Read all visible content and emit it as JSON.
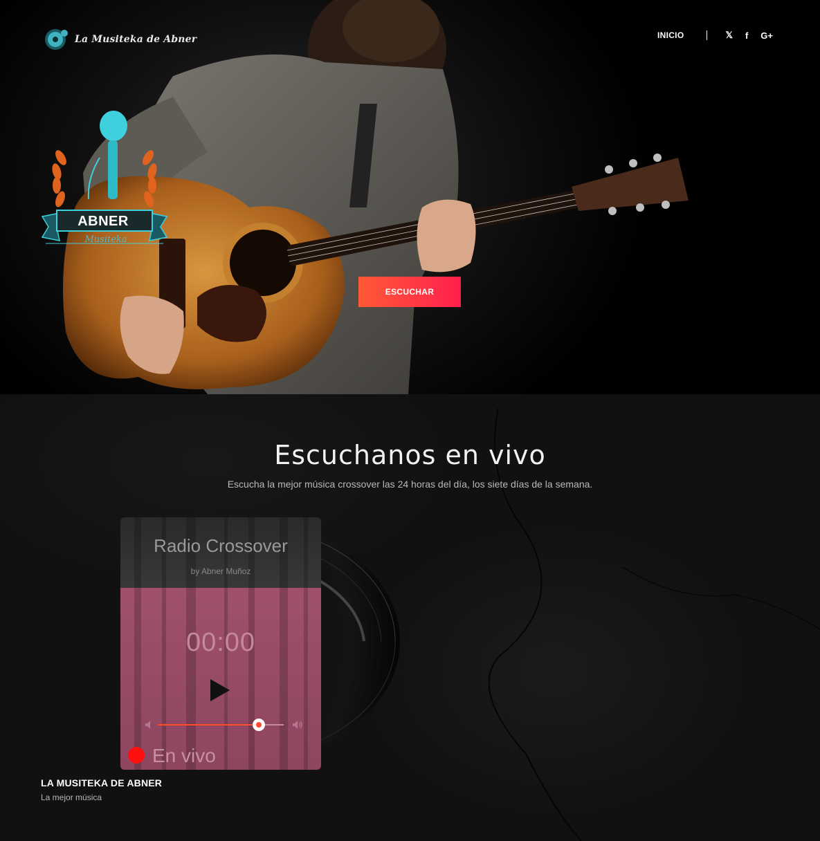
{
  "header": {
    "logo_text": "La Musiteka de Abner",
    "nav": {
      "inicio": "INICIO"
    },
    "social": {
      "twitter": "twitter-icon",
      "facebook": "facebook-icon",
      "google_plus": "google-plus-icon"
    }
  },
  "hero": {
    "badge_name": "ABNER",
    "badge_sub": "Musiteka",
    "cta_label": "ESCUCHAR"
  },
  "live": {
    "title": "Escuchanos en vivo",
    "subtitle": "Escucha la mejor música crossover las 24 horas del día, los siete días de la semana."
  },
  "player": {
    "station": "Radio Crossover",
    "artist": "by Abner Muñoz",
    "time": "00:00",
    "volume_percent": 80,
    "live_label": "En vivo"
  },
  "footer": {
    "brand": "LA MUSITEKA DE ABNER",
    "tagline": "La mejor música"
  },
  "colors": {
    "accent_start": "#ff5a36",
    "accent_end": "#ff1f4e",
    "teal": "#4fb8c7",
    "player_pink": "#a0506a",
    "live_red": "#ff1010"
  }
}
